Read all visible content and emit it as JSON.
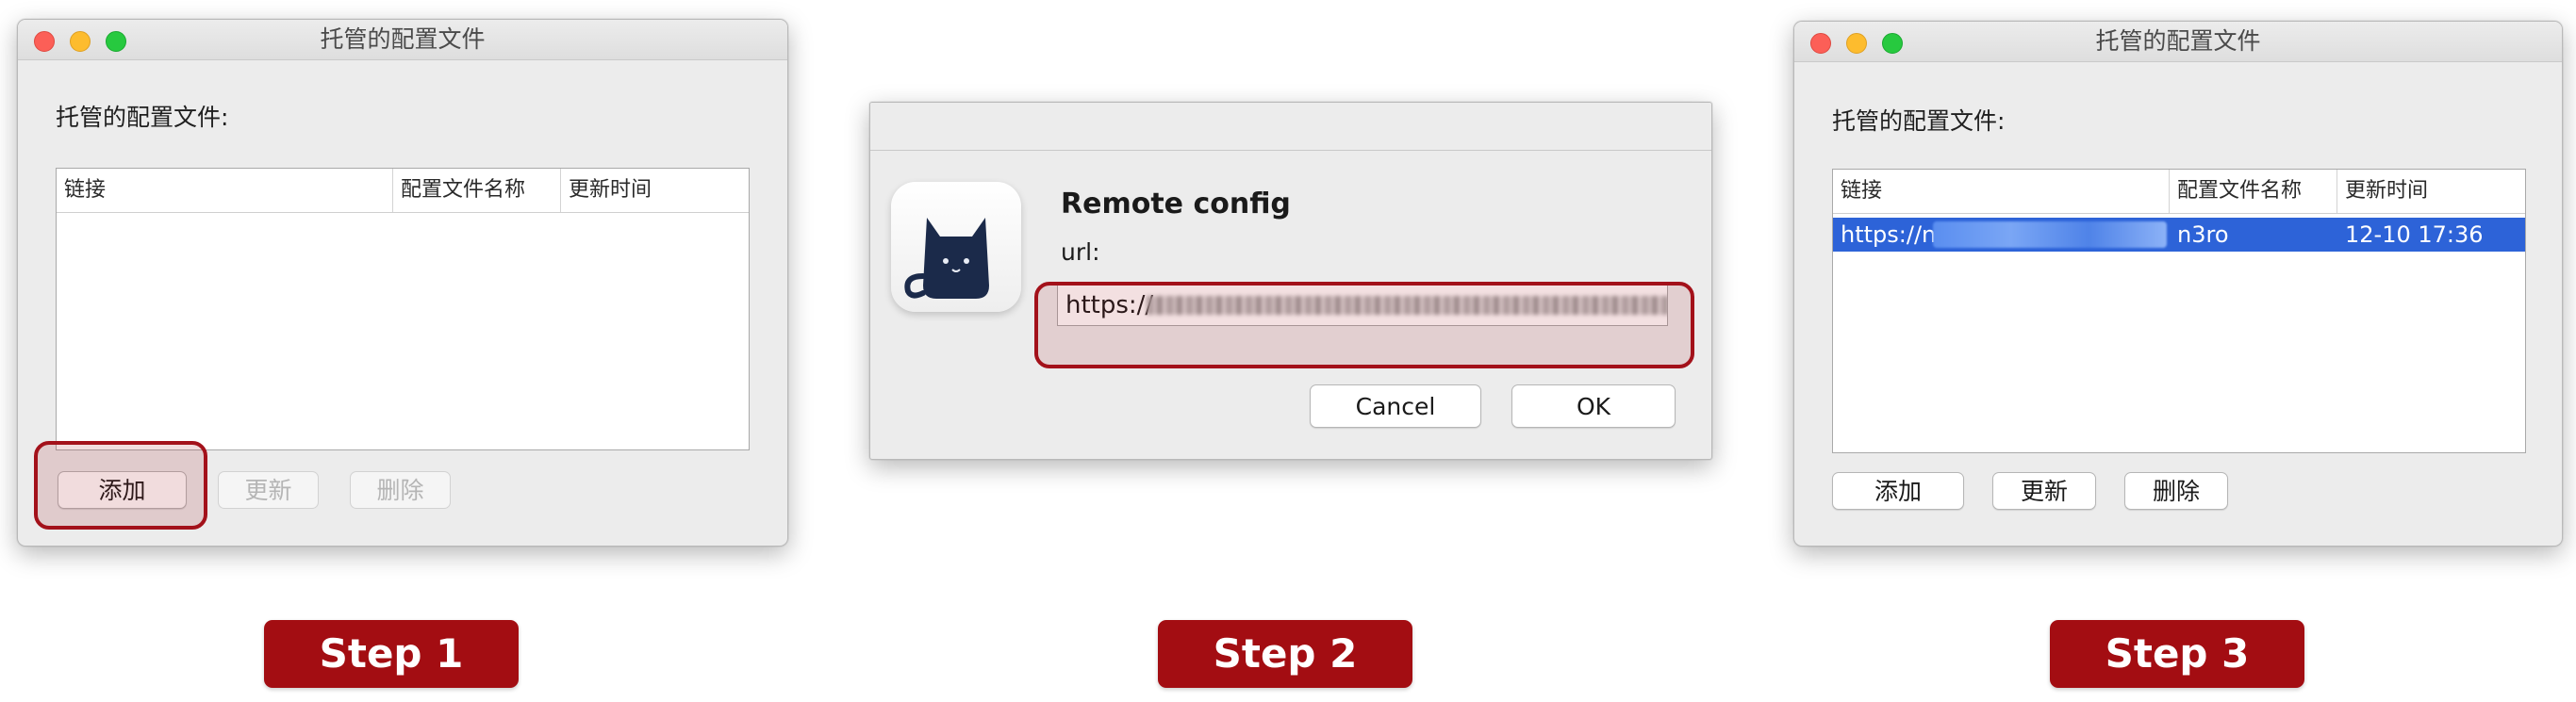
{
  "step1": {
    "window_title": "托管的配置文件",
    "heading": "托管的配置文件:",
    "columns": [
      "链接",
      "配置文件名称",
      "更新时间"
    ],
    "buttons": {
      "add": "添加",
      "update": "更新",
      "delete": "删除"
    },
    "step_label": "Step 1"
  },
  "step2": {
    "title": "Remote config",
    "url_label": "url:",
    "url_value": "https://",
    "cancel": "Cancel",
    "ok": "OK",
    "step_label": "Step 2"
  },
  "step3": {
    "window_title": "托管的配置文件",
    "heading": "托管的配置文件:",
    "columns": [
      "链接",
      "配置文件名称",
      "更新时间"
    ],
    "row": {
      "link": "https://n",
      "name": "n3ro",
      "time": "12-10 17:36"
    },
    "buttons": {
      "add": "添加",
      "update": "更新",
      "delete": "删除"
    },
    "step_label": "Step 3"
  },
  "colors": {
    "highlight": "#a3111a",
    "step_badge": "#a30d12",
    "selection": "#2d63d8",
    "app_icon": "#1b2a4a"
  },
  "icons": [
    "close-light",
    "minimize-light",
    "zoom-light",
    "cat-app-icon"
  ]
}
